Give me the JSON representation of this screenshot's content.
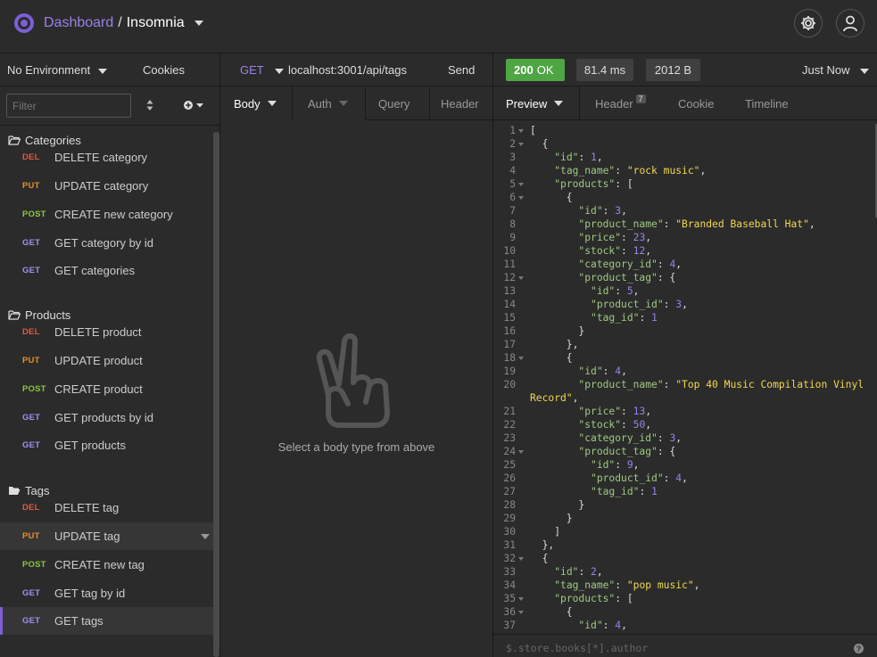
{
  "header": {
    "dashboard_label": "Dashboard",
    "separator": "/",
    "app_label": "Insomnia",
    "icons": [
      "logo-icon",
      "gear-icon",
      "user-icon"
    ]
  },
  "sidebar": {
    "environment_label": "No Environment",
    "cookies_label": "Cookies",
    "filter_placeholder": "Filter",
    "folders": [
      {
        "name": "Categories",
        "requests": [
          {
            "method": "DEL",
            "label": "DELETE category"
          },
          {
            "method": "PUT",
            "label": "UPDATE category"
          },
          {
            "method": "POST",
            "label": "CREATE new category"
          },
          {
            "method": "GET",
            "label": "GET category by id"
          },
          {
            "method": "GET",
            "label": "GET categories"
          }
        ]
      },
      {
        "name": "Products",
        "requests": [
          {
            "method": "DEL",
            "label": "DELETE product"
          },
          {
            "method": "PUT",
            "label": "UPDATE product"
          },
          {
            "method": "POST",
            "label": "CREATE product"
          },
          {
            "method": "GET",
            "label": "GET products by id"
          },
          {
            "method": "GET",
            "label": "GET products"
          }
        ]
      },
      {
        "name": "Tags",
        "requests": [
          {
            "method": "DEL",
            "label": "DELETE tag"
          },
          {
            "method": "PUT",
            "label": "UPDATE tag"
          },
          {
            "method": "POST",
            "label": "CREATE new tag"
          },
          {
            "method": "GET",
            "label": "GET tag by id"
          },
          {
            "method": "GET",
            "label": "GET tags"
          }
        ]
      }
    ],
    "method_colors": {
      "DEL": "#e0583e",
      "PUT": "#ec8c29",
      "POST": "#8cc63f",
      "GET": "#a48ef1"
    }
  },
  "request": {
    "method": "GET",
    "url": "localhost:3001/api/tags",
    "send_label": "Send",
    "tabs": {
      "body": "Body",
      "auth": "Auth",
      "query": "Query",
      "header": "Header"
    },
    "empty_message": "Select a body type from above"
  },
  "response": {
    "status_code": "200",
    "status_text": "OK",
    "time": "81.4 ms",
    "size": "2012 B",
    "time_ago": "Just Now",
    "tabs": {
      "preview": "Preview",
      "header": "Header",
      "header_count": "7",
      "cookie": "Cookie",
      "timeline": "Timeline"
    },
    "query_placeholder": "$.store.books[*].author",
    "help_label": "?",
    "colors": {
      "status": "#4fa544",
      "key": "#9fc982",
      "string": "#f0d84f",
      "number": "#9b80ea"
    },
    "code_lines": [
      {
        "n": "1",
        "fold": true,
        "t": [
          [
            "p",
            "["
          ]
        ]
      },
      {
        "n": "2",
        "fold": true,
        "t": [
          [
            "p",
            "  {"
          ]
        ]
      },
      {
        "n": "3",
        "t": [
          [
            "p",
            "    "
          ],
          [
            "k",
            "\"id\""
          ],
          [
            "p",
            ": "
          ],
          [
            "n",
            "1"
          ],
          [
            "p",
            ","
          ]
        ]
      },
      {
        "n": "4",
        "t": [
          [
            "p",
            "    "
          ],
          [
            "k",
            "\"tag_name\""
          ],
          [
            "p",
            ": "
          ],
          [
            "s",
            "\"rock music\""
          ],
          [
            "p",
            ","
          ]
        ]
      },
      {
        "n": "5",
        "fold": true,
        "t": [
          [
            "p",
            "    "
          ],
          [
            "k",
            "\"products\""
          ],
          [
            "p",
            ": ["
          ]
        ]
      },
      {
        "n": "6",
        "fold": true,
        "t": [
          [
            "p",
            "      {"
          ]
        ]
      },
      {
        "n": "7",
        "t": [
          [
            "p",
            "        "
          ],
          [
            "k",
            "\"id\""
          ],
          [
            "p",
            ": "
          ],
          [
            "n",
            "3"
          ],
          [
            "p",
            ","
          ]
        ]
      },
      {
        "n": "8",
        "t": [
          [
            "p",
            "        "
          ],
          [
            "k",
            "\"product_name\""
          ],
          [
            "p",
            ": "
          ],
          [
            "s",
            "\"Branded Baseball Hat\""
          ],
          [
            "p",
            ","
          ]
        ]
      },
      {
        "n": "9",
        "t": [
          [
            "p",
            "        "
          ],
          [
            "k",
            "\"price\""
          ],
          [
            "p",
            ": "
          ],
          [
            "n",
            "23"
          ],
          [
            "p",
            ","
          ]
        ]
      },
      {
        "n": "10",
        "t": [
          [
            "p",
            "        "
          ],
          [
            "k",
            "\"stock\""
          ],
          [
            "p",
            ": "
          ],
          [
            "n",
            "12"
          ],
          [
            "p",
            ","
          ]
        ]
      },
      {
        "n": "11",
        "t": [
          [
            "p",
            "        "
          ],
          [
            "k",
            "\"category_id\""
          ],
          [
            "p",
            ": "
          ],
          [
            "n",
            "4"
          ],
          [
            "p",
            ","
          ]
        ]
      },
      {
        "n": "12",
        "fold": true,
        "t": [
          [
            "p",
            "        "
          ],
          [
            "k",
            "\"product_tag\""
          ],
          [
            "p",
            ": {"
          ]
        ]
      },
      {
        "n": "13",
        "t": [
          [
            "p",
            "          "
          ],
          [
            "k",
            "\"id\""
          ],
          [
            "p",
            ": "
          ],
          [
            "n",
            "5"
          ],
          [
            "p",
            ","
          ]
        ]
      },
      {
        "n": "14",
        "t": [
          [
            "p",
            "          "
          ],
          [
            "k",
            "\"product_id\""
          ],
          [
            "p",
            ": "
          ],
          [
            "n",
            "3"
          ],
          [
            "p",
            ","
          ]
        ]
      },
      {
        "n": "15",
        "t": [
          [
            "p",
            "          "
          ],
          [
            "k",
            "\"tag_id\""
          ],
          [
            "p",
            ": "
          ],
          [
            "n",
            "1"
          ]
        ]
      },
      {
        "n": "16",
        "t": [
          [
            "p",
            "        }"
          ]
        ]
      },
      {
        "n": "17",
        "t": [
          [
            "p",
            "      },"
          ]
        ]
      },
      {
        "n": "18",
        "fold": true,
        "t": [
          [
            "p",
            "      {"
          ]
        ]
      },
      {
        "n": "19",
        "t": [
          [
            "p",
            "        "
          ],
          [
            "k",
            "\"id\""
          ],
          [
            "p",
            ": "
          ],
          [
            "n",
            "4"
          ],
          [
            "p",
            ","
          ]
        ]
      },
      {
        "n": "20",
        "t": [
          [
            "p",
            "        "
          ],
          [
            "k",
            "\"product_name\""
          ],
          [
            "p",
            ": "
          ],
          [
            "s",
            "\"Top 40 Music Compilation Vinyl"
          ]
        ]
      },
      {
        "n": "",
        "cont": true,
        "t": [
          [
            "s",
            "Record\""
          ],
          [
            "p",
            ","
          ]
        ]
      },
      {
        "n": "21",
        "t": [
          [
            "p",
            "        "
          ],
          [
            "k",
            "\"price\""
          ],
          [
            "p",
            ": "
          ],
          [
            "n",
            "13"
          ],
          [
            "p",
            ","
          ]
        ]
      },
      {
        "n": "22",
        "t": [
          [
            "p",
            "        "
          ],
          [
            "k",
            "\"stock\""
          ],
          [
            "p",
            ": "
          ],
          [
            "n",
            "50"
          ],
          [
            "p",
            ","
          ]
        ]
      },
      {
        "n": "23",
        "t": [
          [
            "p",
            "        "
          ],
          [
            "k",
            "\"category_id\""
          ],
          [
            "p",
            ": "
          ],
          [
            "n",
            "3"
          ],
          [
            "p",
            ","
          ]
        ]
      },
      {
        "n": "24",
        "fold": true,
        "t": [
          [
            "p",
            "        "
          ],
          [
            "k",
            "\"product_tag\""
          ],
          [
            "p",
            ": {"
          ]
        ]
      },
      {
        "n": "25",
        "t": [
          [
            "p",
            "          "
          ],
          [
            "k",
            "\"id\""
          ],
          [
            "p",
            ": "
          ],
          [
            "n",
            "9"
          ],
          [
            "p",
            ","
          ]
        ]
      },
      {
        "n": "26",
        "t": [
          [
            "p",
            "          "
          ],
          [
            "k",
            "\"product_id\""
          ],
          [
            "p",
            ": "
          ],
          [
            "n",
            "4"
          ],
          [
            "p",
            ","
          ]
        ]
      },
      {
        "n": "27",
        "t": [
          [
            "p",
            "          "
          ],
          [
            "k",
            "\"tag_id\""
          ],
          [
            "p",
            ": "
          ],
          [
            "n",
            "1"
          ]
        ]
      },
      {
        "n": "28",
        "t": [
          [
            "p",
            "        }"
          ]
        ]
      },
      {
        "n": "29",
        "t": [
          [
            "p",
            "      }"
          ]
        ]
      },
      {
        "n": "30",
        "t": [
          [
            "p",
            "    ]"
          ]
        ]
      },
      {
        "n": "31",
        "t": [
          [
            "p",
            "  },"
          ]
        ]
      },
      {
        "n": "32",
        "fold": true,
        "t": [
          [
            "p",
            "  {"
          ]
        ]
      },
      {
        "n": "33",
        "t": [
          [
            "p",
            "    "
          ],
          [
            "k",
            "\"id\""
          ],
          [
            "p",
            ": "
          ],
          [
            "n",
            "2"
          ],
          [
            "p",
            ","
          ]
        ]
      },
      {
        "n": "34",
        "t": [
          [
            "p",
            "    "
          ],
          [
            "k",
            "\"tag_name\""
          ],
          [
            "p",
            ": "
          ],
          [
            "s",
            "\"pop music\""
          ],
          [
            "p",
            ","
          ]
        ]
      },
      {
        "n": "35",
        "fold": true,
        "t": [
          [
            "p",
            "    "
          ],
          [
            "k",
            "\"products\""
          ],
          [
            "p",
            ": ["
          ]
        ]
      },
      {
        "n": "36",
        "fold": true,
        "t": [
          [
            "p",
            "      {"
          ]
        ]
      },
      {
        "n": "37",
        "t": [
          [
            "p",
            "        "
          ],
          [
            "k",
            "\"id\""
          ],
          [
            "p",
            ": "
          ],
          [
            "n",
            "4"
          ],
          [
            "p",
            ","
          ]
        ]
      }
    ]
  }
}
